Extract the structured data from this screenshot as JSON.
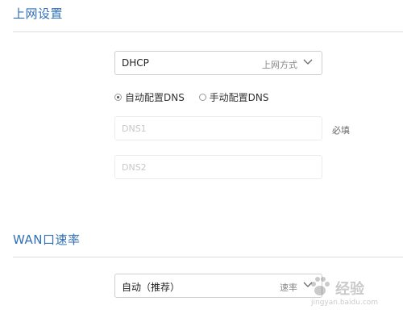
{
  "internet_settings": {
    "title": "上网设置",
    "connection": {
      "value": "DHCP",
      "caption": "上网方式"
    },
    "dns_mode": {
      "options": [
        {
          "label": "自动配置DNS",
          "checked": true
        },
        {
          "label": "手动配置DNS",
          "checked": false
        }
      ]
    },
    "dns1": {
      "placeholder": "DNS1",
      "note": "必填"
    },
    "dns2": {
      "placeholder": "DNS2"
    }
  },
  "wan_speed": {
    "title": "WAN口速率",
    "select": {
      "value": "自动（推荐）",
      "caption": "速率"
    }
  },
  "watermark": {
    "text": "经验",
    "url": "jingyan.baidu.com"
  },
  "colors": {
    "title_blue": "#2f6fb7",
    "border": "#cfcfcf"
  }
}
